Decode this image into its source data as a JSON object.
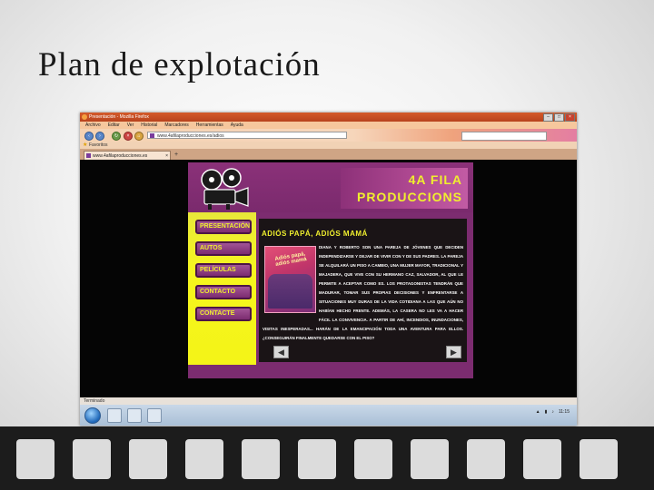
{
  "slide": {
    "title": "Plan de explotación"
  },
  "browser": {
    "window_title": "Presentación - Mozilla Firefox",
    "menu": [
      "Archivo",
      "Editar",
      "Ver",
      "Historial",
      "Marcadores",
      "Herramientas",
      "Ayuda"
    ],
    "url": "www.4afilaproducciones.es/adios",
    "bookmarks_label": "Favoritos",
    "tab_title": "www.4afilaproducciones.es",
    "status": "Terminado"
  },
  "site": {
    "brand_line1": "4A FILA",
    "brand_line2": "PRODUCCIONS",
    "nav": [
      "PRESENTACIÓN",
      "AUTOS",
      "PELÍCULAS",
      "CONTACTO",
      "CONTACTE"
    ],
    "article_title": "ADIÓS PAPÁ, ADIÓS MAMÁ",
    "poster_title": "Adiós papá, adiós mamá",
    "article_body": "DIANA Y ROBERTO SON UNA PAREJA DE JÓVENES QUE DECIDEN INDEPENDIZARSE Y DEJAR DE VIVIR CON Y DE SUS PADRES. LA PAREJA SE ALQUILARÁ UN PISO A CAMBIO, UNA MUJER MAYOR, TRADICIONAL Y MAJADERA, QUE VIVE CON SU HERMANO CAZ, SALVADOR, AL QUE LE PERMITE A ACEPTAR COMO ES. LOS PROTAGONISTAS TENDRÁN QUE MADURAR, TOMAR SUS PROPIAS DECISIONES Y ENFRENTARSE A SITUACIONES MUY DURAS DE LA VIDA COTIDIANA A LAS QUE AÚN NO HABÍAN HECHO FRENTE. ADEMÁS, LA CASERA NO LES VA A HACER FÁCIL LA CONVIVENCIA. A PARTIR DE AHÍ, INCENDIOS, INUNDACIONES, VISITAS INESPERADAS... HARÁN DE LA EMANCIPACIÓN TODA UNA AVENTURA PARA ELLOS. ¿CONSEGUIRÁN FINALMENTE QUEDARSE CON EL PISO?"
  },
  "taskbar": {
    "clock": "11:15"
  }
}
